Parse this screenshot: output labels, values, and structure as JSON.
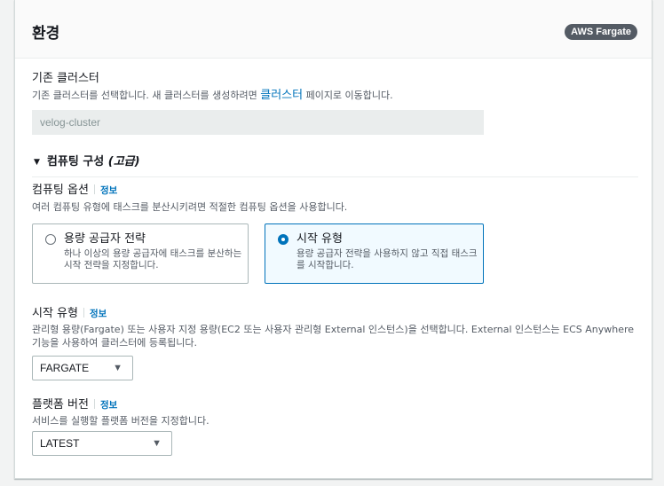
{
  "section": {
    "title": "환경",
    "badge": "AWS Fargate"
  },
  "existing_cluster": {
    "label": "기존 클러스터",
    "desc_before": "기존 클러스터를 선택합니다. 새 클러스터를 생성하려면 ",
    "desc_link": "클러스터",
    "desc_after": " 페이지로 이동합니다.",
    "value": "velog-cluster"
  },
  "compute_config": {
    "heading": "컴퓨팅 구성",
    "heading_suffix": "(고급)",
    "options_label": "컴퓨팅 옵션",
    "info": "정보",
    "options_desc": "여러 컴퓨팅 유형에 태스크를 분산시키려면 적절한 컴퓨팅 옵션을 사용합니다.",
    "tiles": [
      {
        "title": "용량 공급자 전략",
        "desc": "하나 이상의 용량 공급자에 태스크를 분산하는 시작 전략을 지정합니다.",
        "selected": false
      },
      {
        "title": "시작 유형",
        "desc": "용량 공급자 전략을 사용하지 않고 직접 태스크를 시작합니다.",
        "selected": true
      }
    ]
  },
  "launch_type": {
    "label": "시작 유형",
    "info": "정보",
    "desc": "관리형 용량(Fargate) 또는 사용자 지정 용량(EC2 또는 사용자 관리형 External 인스턴스)을 선택합니다. External 인스턴스는 ECS Anywhere 기능을 사용하여 클러스터에 등록됩니다.",
    "value": "FARGATE"
  },
  "platform_version": {
    "label": "플랫폼 버전",
    "info": "정보",
    "desc": "서비스를 실행할 플랫폼 버전을 지정합니다.",
    "value": "LATEST"
  },
  "colors": {
    "accent": "#0073bb",
    "badge_bg": "#545b64"
  }
}
